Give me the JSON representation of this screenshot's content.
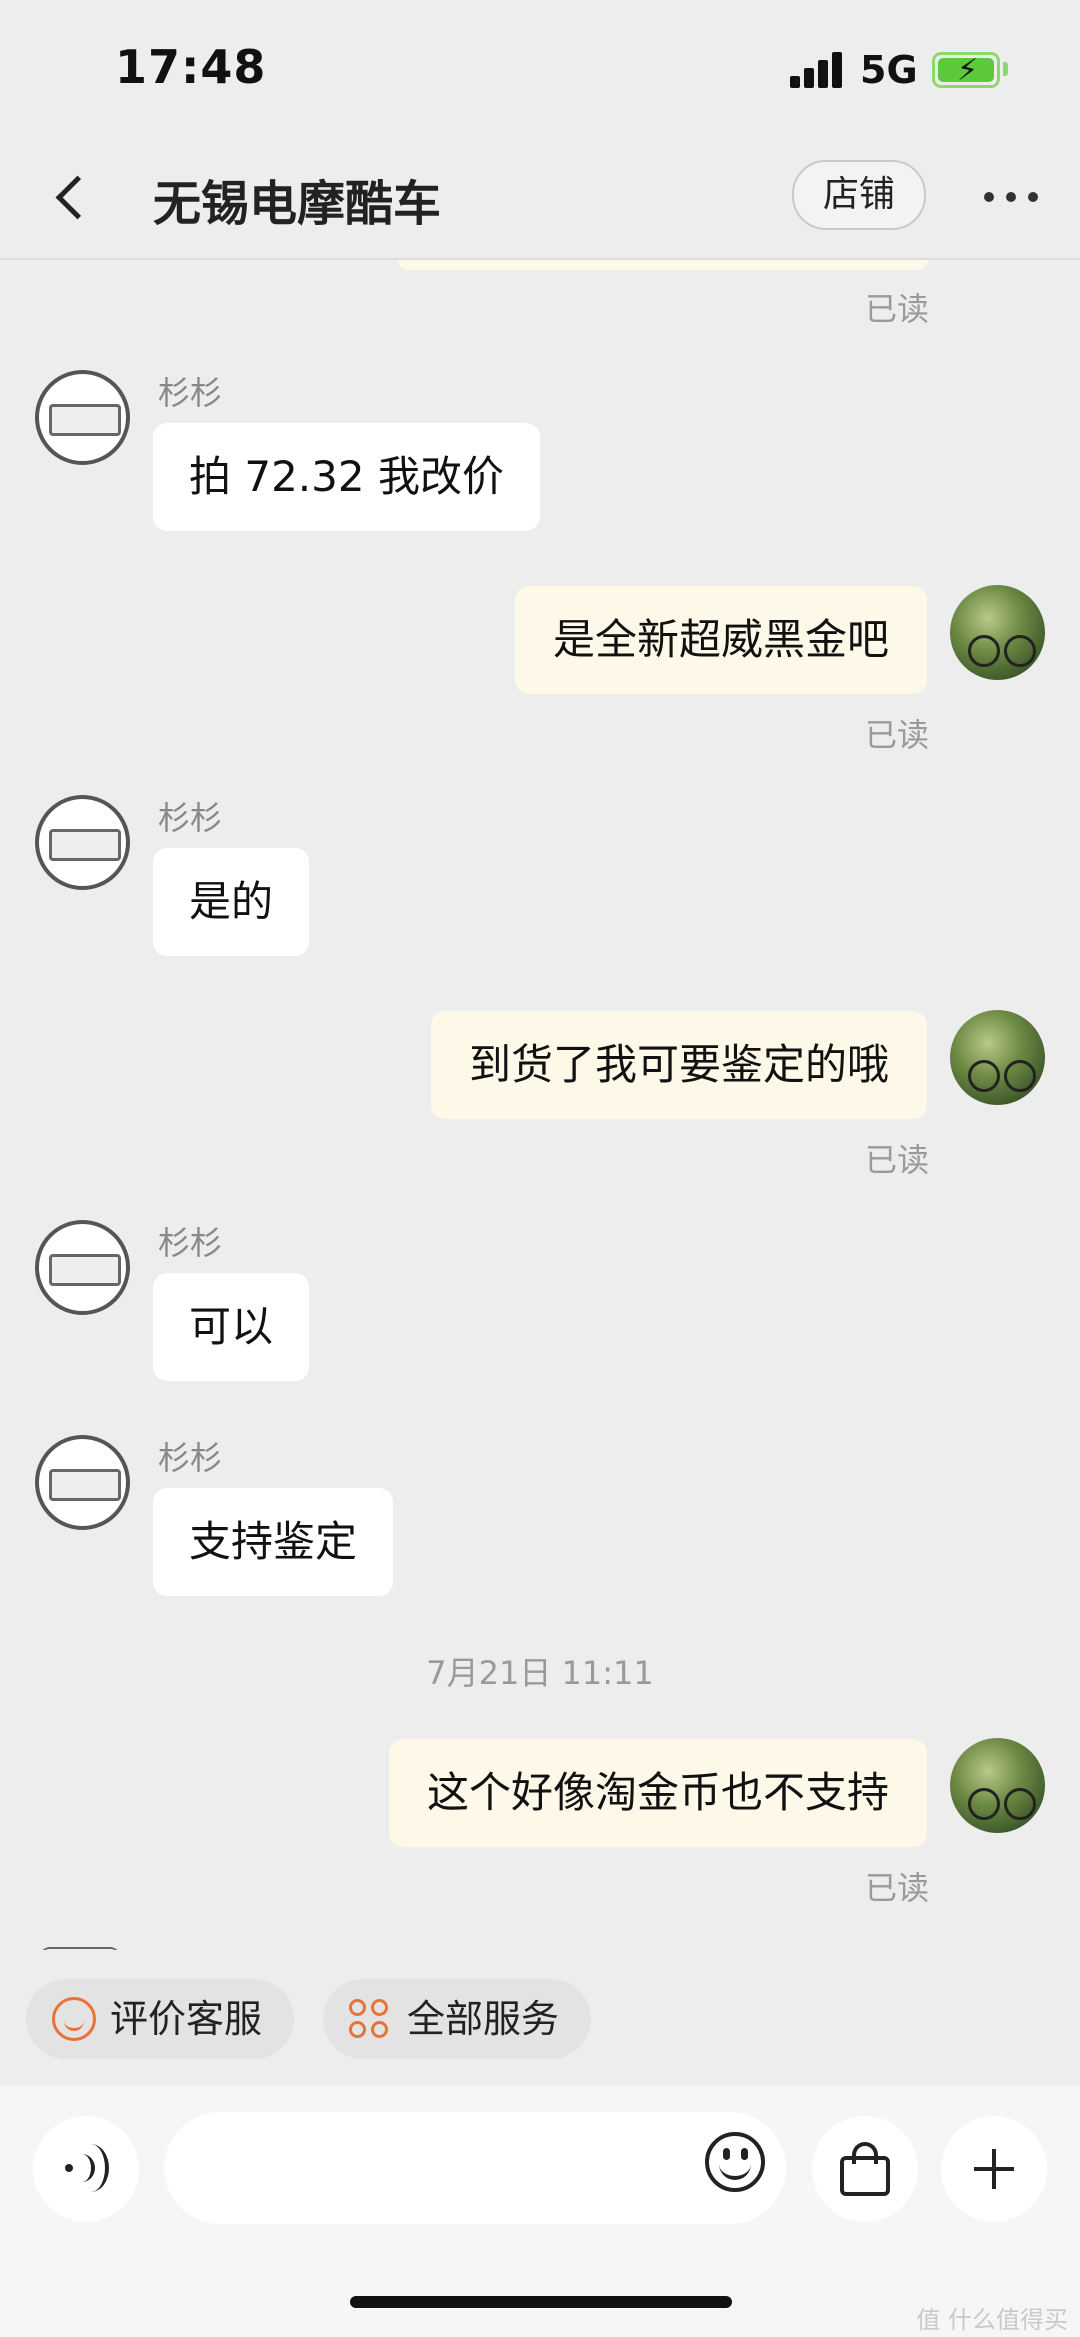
{
  "status_bar": {
    "time": "17:48",
    "network": "5G",
    "battery_state": "charging"
  },
  "header": {
    "title": "无锡电摩酷车",
    "shop_button": "店铺"
  },
  "chat": {
    "read_label": "已读",
    "messages": [
      {
        "sender": "杉杉",
        "text": "拍 72.32 我改价"
      },
      {
        "text": "是全新超威黑金吧"
      },
      {
        "sender": "杉杉",
        "text": "是的"
      },
      {
        "text": "到货了我可要鉴定的哦"
      },
      {
        "sender": "杉杉",
        "text": "可以"
      },
      {
        "sender": "杉杉",
        "text": "支持鉴定"
      },
      {
        "timestamp": "7月21日 11:11"
      },
      {
        "text": "这个好像淘金币也不支持"
      }
    ]
  },
  "quick_actions": [
    {
      "label": "评价客服",
      "icon": "smiley-face-icon"
    },
    {
      "label": "全部服务",
      "icon": "services-grid-icon"
    }
  ],
  "input_bar": {
    "value": "",
    "placeholder": ""
  },
  "colors": {
    "accent": "#e8733a",
    "outgoing_bubble": "#fdf8e8",
    "incoming_bubble": "#ffffff",
    "background": "#ededed"
  },
  "watermark": "值 什么值得买"
}
